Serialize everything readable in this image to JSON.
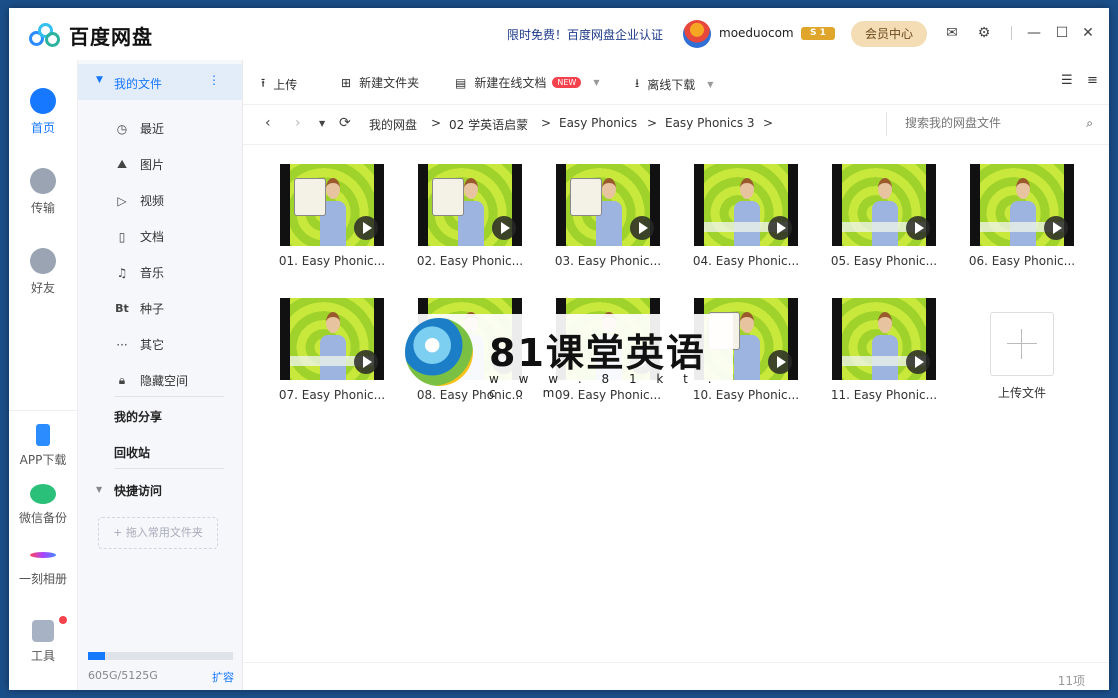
{
  "app": {
    "title": "百度网盘",
    "promo": "限时免费！百度网盘企业认证",
    "username": "moeduocom",
    "vip_badge": "S 1",
    "member_center": "会员中心"
  },
  "left_nav": [
    {
      "label": "首页",
      "icon": "cloud-icon"
    },
    {
      "label": "传输",
      "icon": "transfer-icon"
    },
    {
      "label": "好友",
      "icon": "friends-icon"
    },
    {
      "label": "APP下载",
      "icon": "phone-icon"
    },
    {
      "label": "微信备份",
      "icon": "wechat-icon"
    },
    {
      "label": "一刻相册",
      "icon": "album-icon"
    },
    {
      "label": "工具",
      "icon": "tools-icon"
    }
  ],
  "sidebar": {
    "my_files": "我的文件",
    "items": [
      "最近",
      "图片",
      "视频",
      "文档",
      "音乐",
      "种子",
      "其它",
      "隐藏空间"
    ],
    "bt_glyph": "Bt",
    "my_share": "我的分享",
    "recycle": "回收站",
    "quick_access": "快捷访问",
    "quick_add": "+ 拖入常用文件夹",
    "storage_text": "605G/5125G",
    "storage_used": 0.118,
    "expand": "扩容"
  },
  "toolbar": {
    "upload": "上传",
    "new_folder": "新建文件夹",
    "new_online_doc": "新建在线文档",
    "new_badge": "NEW",
    "offline_download": "离线下载"
  },
  "breadcrumb": [
    "我的网盘",
    "02 学英语启蒙",
    "Easy Phonics",
    "Easy Phonics 3"
  ],
  "search": {
    "placeholder": "搜索我的网盘文件"
  },
  "files": [
    "01. Easy Phonic...",
    "02. Easy Phonic...",
    "03. Easy Phonic...",
    "04. Easy Phonic...",
    "05. Easy Phonic...",
    "06. Easy Phonic...",
    "07. Easy Phonic...",
    "08. Easy Phonic...",
    "09. Easy Phonic...",
    "10. Easy Phonic...",
    "11. Easy Phonic..."
  ],
  "upload_file": "上传文件",
  "item_count": "11项",
  "watermark": {
    "text": "81课堂英语",
    "url": "w w w . 8 1 k t . c o m"
  },
  "colors": {
    "accent": "#1677ff",
    "thumb_green": "#c8e83b",
    "badge_red": "#f5424c"
  }
}
